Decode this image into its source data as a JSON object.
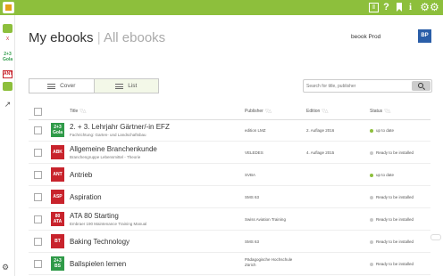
{
  "topbar": {
    "app_icon": "book-app-icon",
    "icons": [
      "library-icon",
      "help-icon",
      "bookmark-icon",
      "info-icon",
      "settings-icon"
    ],
    "help_glyph": "?",
    "info_glyph": "i"
  },
  "leftbar": {
    "items": [
      {
        "icon": "green-book-icon"
      },
      {
        "icon": "red-book-icon",
        "label": "X"
      },
      {
        "icon": "book-cover-icon",
        "label": "2+3 Gola"
      },
      {
        "icon": "book-cover-icon",
        "label": "ANT"
      },
      {
        "icon": "green-book-icon"
      },
      {
        "icon": "export-icon"
      }
    ]
  },
  "header": {
    "title": "My ebooks",
    "separator": "|",
    "other": "All ebooks",
    "user_name": "beook Prod",
    "user_initials": "BP"
  },
  "view": {
    "cover_label": "Cover",
    "list_label": "List",
    "active": "list"
  },
  "search": {
    "placeholder": "Search for title, publisher"
  },
  "table": {
    "columns": [
      "Title",
      "Publisher",
      "Edition",
      "Status"
    ],
    "rows": [
      {
        "cover_label": "2+3 Gola",
        "cover_color": "#2f9a48",
        "title": "2. + 3. Lehrjahr Gärtner/-in EFZ",
        "subtitle": "Fachrichtung: Garten- und Landschaftsbau",
        "publisher": "edition LMZ",
        "edition": "2. Auflage 2016",
        "status": "up to date",
        "status_color": "#8dbf3c"
      },
      {
        "cover_label": "ABK",
        "cover_color": "#c8232c",
        "title": "Allgemeine Branchenkunde",
        "subtitle": "Branchengruppe Lebensmittel - Theorie",
        "publisher": "VELEDES",
        "edition": "4. Auflage 2015",
        "status": "Ready to be installed",
        "status_color": "#c8c8c8"
      },
      {
        "cover_label": "ANT",
        "cover_color": "#c8232c",
        "title": "Antrieb",
        "subtitle": "",
        "publisher": "SVBA",
        "edition": "",
        "status": "up to date",
        "status_color": "#8dbf3c"
      },
      {
        "cover_label": "ASP",
        "cover_color": "#c8232c",
        "title": "Aspiration",
        "subtitle": "",
        "publisher": "SMS 63",
        "edition": "",
        "status": "Ready to be installed",
        "status_color": "#c8c8c8"
      },
      {
        "cover_label": "80 ATA",
        "cover_color": "#c8232c",
        "title": "ATA 80 Starting",
        "subtitle": "Embraer 190 Maintenance Training Manual",
        "publisher": "Swiss Aviation Training",
        "edition": "",
        "status": "Ready to be installed",
        "status_color": "#c8c8c8"
      },
      {
        "cover_label": "BT",
        "cover_color": "#c8232c",
        "title": "Baking Technology",
        "subtitle": "",
        "publisher": "SMS 63",
        "edition": "",
        "status": "Ready to be installed",
        "status_color": "#c8c8c8"
      },
      {
        "cover_label": "2+3 BS",
        "cover_color": "#2f9a48",
        "title": "Ballspielen lernen",
        "subtitle": "",
        "publisher": "Pädagogische Hochschule Zürich",
        "edition": "",
        "status": "Ready to be installed",
        "status_color": "#c8c8c8"
      }
    ]
  },
  "footer": {
    "icon": "share-settings-icon"
  }
}
